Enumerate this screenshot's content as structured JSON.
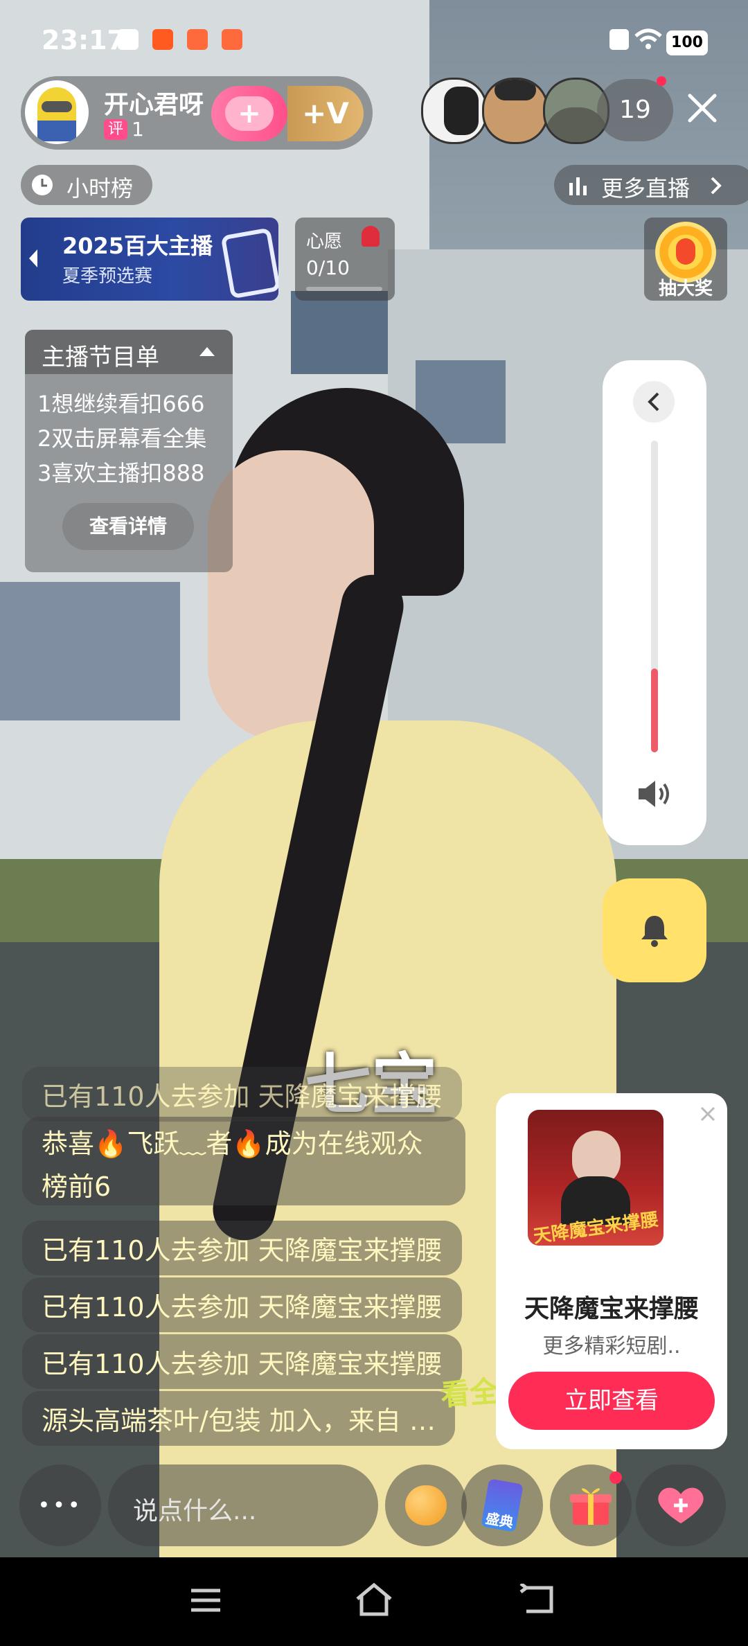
{
  "status_bar": {
    "time": "23:17",
    "battery": "100"
  },
  "streamer": {
    "name": "开心君呀",
    "level_badge": "评",
    "level": "1",
    "follow_symbol": "+",
    "fan_symbol": "+V"
  },
  "viewers": {
    "count": "19"
  },
  "hour_rank": {
    "label": "小时榜"
  },
  "more_live": {
    "label": "更多直播"
  },
  "banner": {
    "title": "2025百大主播",
    "subtitle": "夏季预选赛"
  },
  "wish": {
    "label": "心愿",
    "progress": "0/10",
    "fraction": 0.0
  },
  "lottery": {
    "label": "抽大奖"
  },
  "program": {
    "title": "主播节目单",
    "items": [
      "1想继续看扣666",
      "2双击屏幕看全集",
      "3喜欢主播扣888"
    ],
    "details_button": "查看详情"
  },
  "volume": {
    "level": 0.27
  },
  "video_caption": "七宝",
  "chat": [
    "已有110人去参加 天降魔宝来撑腰",
    "恭喜🔥飞跃﹏者🔥成为在线观众",
    "榜前6",
    "已有110人去参加 天降魔宝来撑腰",
    "已有110人去参加 天降魔宝来撑腰",
    "已有110人去参加 天降魔宝来撑腰",
    "源头高端茶叶/包装 加入，来自 …"
  ],
  "promo_card": {
    "title": "天降魔宝来撑腰",
    "subtitle": "更多精彩短剧..",
    "button": "立即查看",
    "poster_text": "天降魔宝来撑腰"
  },
  "overlay_watermark": [
    "看全集"
  ],
  "bottom_bar": {
    "more_dots": "•••",
    "input_placeholder": "说点什么...",
    "badge_text": "盛典"
  },
  "colors": {
    "accent_pink": "#ff2d55",
    "bell_yellow": "#ffe16b",
    "chat_text": "#fff6c0"
  }
}
